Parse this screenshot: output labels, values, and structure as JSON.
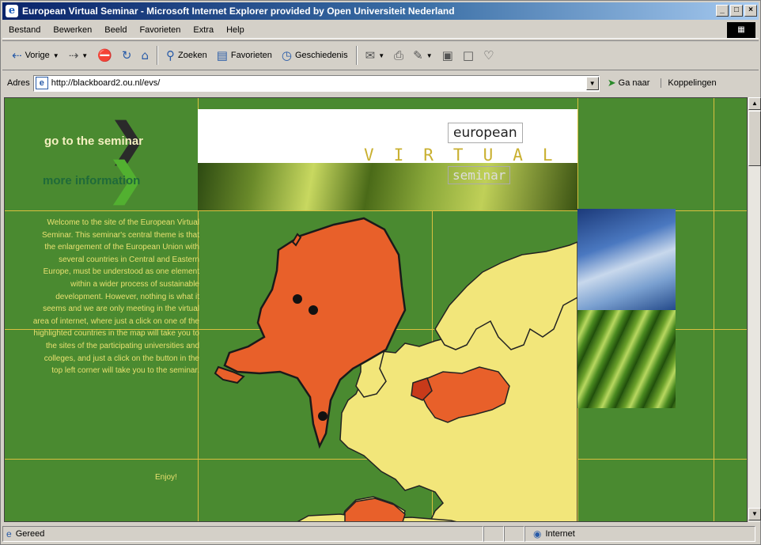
{
  "window": {
    "title": "European Virtual Seminar - Microsoft Internet Explorer provided by Open Universiteit Nederland",
    "controls": [
      "_",
      "□",
      "×"
    ]
  },
  "menu": [
    "Bestand",
    "Bewerken",
    "Beeld",
    "Favorieten",
    "Extra",
    "Help"
  ],
  "toolbar": {
    "back": "Vorige",
    "search": "Zoeken",
    "favorites": "Favorieten",
    "history": "Geschiedenis"
  },
  "address": {
    "label": "Adres",
    "url": "http://blackboard2.ou.nl/evs/",
    "go": "Ga naar",
    "links": "Koppelingen"
  },
  "page": {
    "nav_seminar": "go to the seminar",
    "nav_info": "more information",
    "banner_european": "european",
    "banner_virtual": "VIRTUAL",
    "banner_seminar": "seminar",
    "welcome": "Welcome to the site of the European Virtual Seminar. This seminar's central theme is that the enlargement of the European Union with several countries in Central and Eastern Europe, must be understood as one element within a wider process of sustainable development. However, nothing is what it seems and we are only meeting in the virtual area of internet, where just a click on one of the highlighted countries in the map will take you to the sites of the participating universities and colleges, and just a click on the button in the top left corner will take you to the seminar.",
    "enjoy": "Enjoy!"
  },
  "status": {
    "left": "Gereed",
    "zone": "Internet"
  },
  "colors": {
    "page_green": "#4a8a30",
    "highlight_orange": "#e8602a",
    "europe_yellow": "#f2e67a",
    "grid_gold": "#d8c040"
  }
}
